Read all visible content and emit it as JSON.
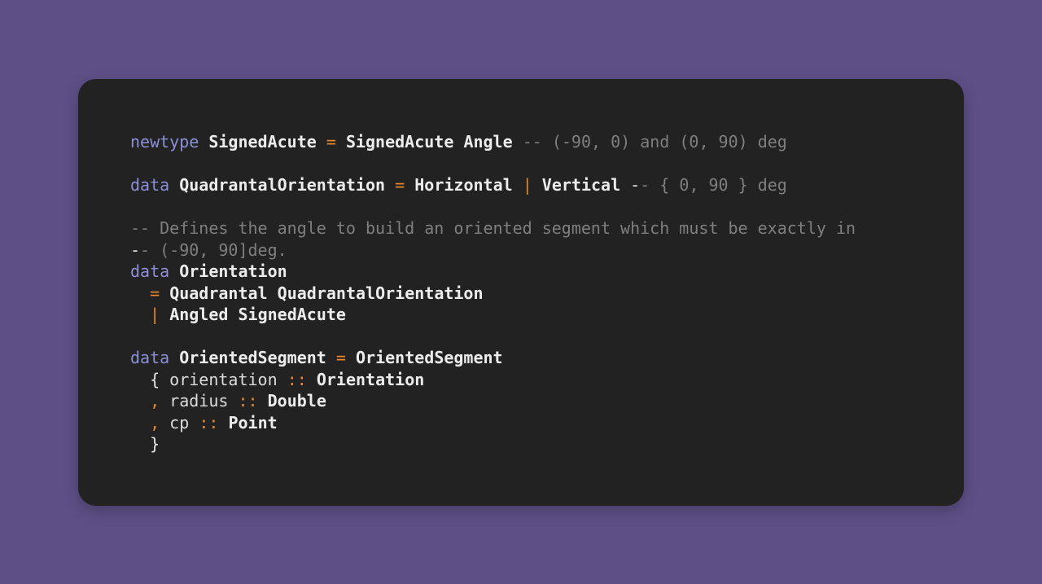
{
  "code": {
    "lines": [
      [
        {
          "t": "newtype",
          "k": "kw"
        },
        {
          "t": " ",
          "k": "id"
        },
        {
          "t": "SignedAcute",
          "k": "ty"
        },
        {
          "t": " ",
          "k": "id"
        },
        {
          "t": "=",
          "k": "op"
        },
        {
          "t": " ",
          "k": "id"
        },
        {
          "t": "SignedAcute",
          "k": "ty"
        },
        {
          "t": " ",
          "k": "id"
        },
        {
          "t": "Angle",
          "k": "ty"
        },
        {
          "t": " ",
          "k": "id"
        },
        {
          "t": "-- (-90, 0) and (0, 90) deg",
          "k": "cm"
        }
      ],
      [],
      [
        {
          "t": "data",
          "k": "kw"
        },
        {
          "t": " ",
          "k": "id"
        },
        {
          "t": "QuadrantalOrientation",
          "k": "ty"
        },
        {
          "t": " ",
          "k": "id"
        },
        {
          "t": "=",
          "k": "op"
        },
        {
          "t": " ",
          "k": "id"
        },
        {
          "t": "Horizontal",
          "k": "ty"
        },
        {
          "t": " ",
          "k": "id"
        },
        {
          "t": "|",
          "k": "op"
        },
        {
          "t": " ",
          "k": "id"
        },
        {
          "t": "Vertical",
          "k": "ty"
        },
        {
          "t": " ",
          "k": "id"
        },
        {
          "t": "-",
          "k": "pu"
        },
        {
          "t": "- { 0, 90 } deg",
          "k": "cm"
        }
      ],
      [],
      [
        {
          "t": "-- Defines the angle to build an oriented segment which must be exactly in",
          "k": "cm"
        }
      ],
      [
        {
          "t": "-",
          "k": "pu"
        },
        {
          "t": "- (-90, 90]deg.",
          "k": "cm"
        }
      ],
      [
        {
          "t": "data",
          "k": "kw"
        },
        {
          "t": " ",
          "k": "id"
        },
        {
          "t": "Orientation",
          "k": "ty"
        }
      ],
      [
        {
          "t": "  ",
          "k": "id"
        },
        {
          "t": "=",
          "k": "op"
        },
        {
          "t": " ",
          "k": "id"
        },
        {
          "t": "Quadrantal",
          "k": "ty"
        },
        {
          "t": " ",
          "k": "id"
        },
        {
          "t": "QuadrantalOrientation",
          "k": "ty"
        }
      ],
      [
        {
          "t": "  ",
          "k": "id"
        },
        {
          "t": "|",
          "k": "op"
        },
        {
          "t": " ",
          "k": "id"
        },
        {
          "t": "Angled",
          "k": "ty"
        },
        {
          "t": " ",
          "k": "id"
        },
        {
          "t": "SignedAcute",
          "k": "ty"
        }
      ],
      [],
      [
        {
          "t": "data",
          "k": "kw"
        },
        {
          "t": " ",
          "k": "id"
        },
        {
          "t": "OrientedSegment",
          "k": "ty"
        },
        {
          "t": " ",
          "k": "id"
        },
        {
          "t": "=",
          "k": "op"
        },
        {
          "t": " ",
          "k": "id"
        },
        {
          "t": "OrientedSegment",
          "k": "ty"
        }
      ],
      [
        {
          "t": "  ",
          "k": "id"
        },
        {
          "t": "{",
          "k": "pu"
        },
        {
          "t": " orientation ",
          "k": "id"
        },
        {
          "t": "::",
          "k": "op"
        },
        {
          "t": " ",
          "k": "id"
        },
        {
          "t": "Orientation",
          "k": "ty"
        }
      ],
      [
        {
          "t": "  ",
          "k": "id"
        },
        {
          "t": ",",
          "k": "op"
        },
        {
          "t": " radius ",
          "k": "id"
        },
        {
          "t": "::",
          "k": "op"
        },
        {
          "t": " ",
          "k": "id"
        },
        {
          "t": "Double",
          "k": "ty"
        }
      ],
      [
        {
          "t": "  ",
          "k": "id"
        },
        {
          "t": ",",
          "k": "op"
        },
        {
          "t": " cp ",
          "k": "id"
        },
        {
          "t": "::",
          "k": "op"
        },
        {
          "t": " ",
          "k": "id"
        },
        {
          "t": "Point",
          "k": "ty"
        }
      ],
      [
        {
          "t": "  ",
          "k": "id"
        },
        {
          "t": "}",
          "k": "pu"
        }
      ]
    ]
  },
  "colors": {
    "background": "#5e5087",
    "card": "#222222",
    "keyword": "#8d8fd6",
    "type": "#ececec",
    "operator": "#e6872f",
    "comment": "#7f7f7f"
  }
}
